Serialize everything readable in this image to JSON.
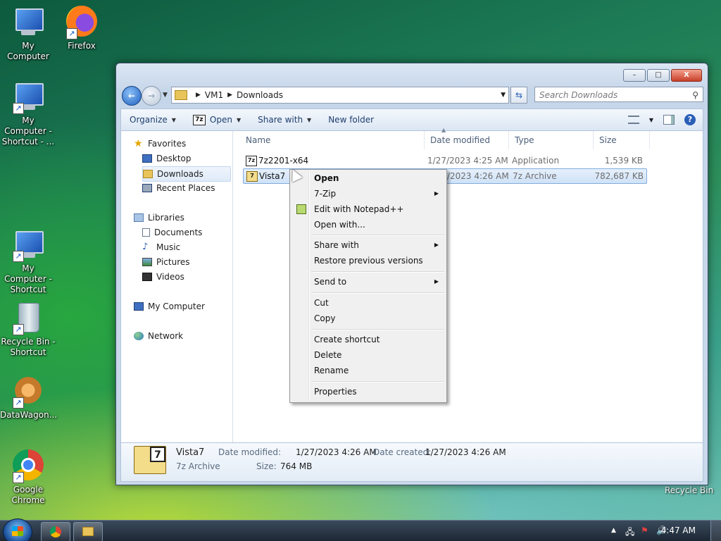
{
  "desktop": {
    "icons": [
      {
        "label": "My Computer"
      },
      {
        "label": "Firefox"
      },
      {
        "label": "My Computer - Shortcut - ..."
      },
      {
        "label": "My Computer - Shortcut"
      },
      {
        "label": "Recycle Bin - Shortcut"
      },
      {
        "label": "DataWagon..."
      },
      {
        "label": "Google Chrome"
      }
    ],
    "recycle_bin_label": "Recycle Bin"
  },
  "window": {
    "controls": {
      "minimize": "–",
      "maximize": "□",
      "close": "X"
    },
    "address": {
      "parts": [
        "VM1",
        "Downloads"
      ]
    },
    "search": {
      "placeholder": "Search Downloads"
    },
    "toolbar": {
      "organize": "Organize",
      "open": "Open",
      "share_with": "Share with",
      "new_folder": "New folder"
    }
  },
  "nav_pane": {
    "favorites": "Favorites",
    "favorites_items": [
      "Desktop",
      "Downloads",
      "Recent Places"
    ],
    "libraries": "Libraries",
    "libraries_items": [
      "Documents",
      "Music",
      "Pictures",
      "Videos"
    ],
    "my_computer": "My Computer",
    "network": "Network"
  },
  "file_list": {
    "columns": [
      "Name",
      "Date modified",
      "Type",
      "Size"
    ],
    "rows": [
      {
        "name": "7z2201-x64",
        "date": "1/27/2023 4:25 AM",
        "type": "Application",
        "size": "1,539 KB"
      },
      {
        "name": "Vista7",
        "date": "1/27/2023 4:26 AM",
        "type": "7z Archive",
        "size": "782,687 KB"
      }
    ]
  },
  "context_menu": {
    "items": {
      "open": "Open",
      "zip": "7-Zip",
      "notepad": "Edit with Notepad++",
      "open_with": "Open with...",
      "share_with": "Share with",
      "restore": "Restore previous versions",
      "send_to": "Send to",
      "cut": "Cut",
      "copy": "Copy",
      "create_shortcut": "Create shortcut",
      "delete": "Delete",
      "rename": "Rename",
      "properties": "Properties"
    }
  },
  "details": {
    "name": "Vista7",
    "type": "7z Archive",
    "date_modified_label": "Date modified:",
    "date_modified": "1/27/2023 4:26 AM",
    "date_created_label": "Date created:",
    "date_created": "1/27/2023 4:26 AM",
    "size_label": "Size:",
    "size": "764 MB"
  },
  "taskbar": {
    "clock": "4:47 AM"
  }
}
